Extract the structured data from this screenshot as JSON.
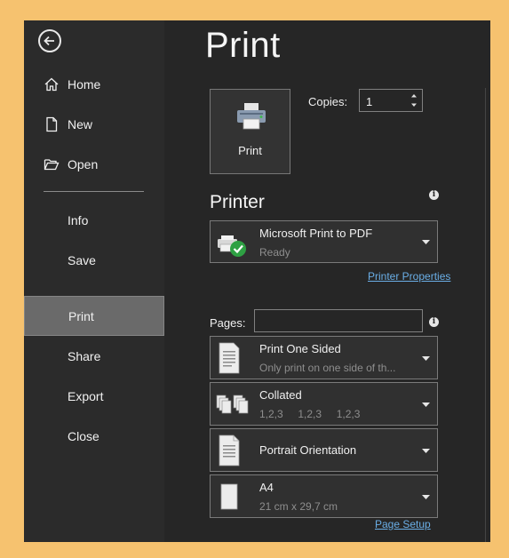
{
  "sidebar": {
    "items": [
      {
        "label": "Home",
        "icon": "home-icon"
      },
      {
        "label": "New",
        "icon": "new-document-icon"
      },
      {
        "label": "Open",
        "icon": "folder-open-icon"
      },
      {
        "label": "Info"
      },
      {
        "label": "Save"
      },
      {
        "label": "Print",
        "active": true
      },
      {
        "label": "Share"
      },
      {
        "label": "Export"
      },
      {
        "label": "Close"
      }
    ]
  },
  "main": {
    "title": "Print",
    "print_button_label": "Print",
    "copies_label": "Copies:",
    "copies_value": "1",
    "printer_section_title": "Printer",
    "printer": {
      "name": "Microsoft Print to PDF",
      "status": "Ready"
    },
    "printer_properties_link": "Printer Properties",
    "pages_label": "Pages:",
    "pages_value": "",
    "sides": {
      "title": "Print One Sided",
      "subtitle": "Only print on one side of th..."
    },
    "collation": {
      "title": "Collated",
      "sequence": [
        "1,2,3",
        "1,2,3",
        "1,2,3"
      ]
    },
    "orientation": {
      "title": "Portrait Orientation"
    },
    "paper": {
      "title": "A4",
      "subtitle": "21 cm x 29,7 cm"
    },
    "page_setup_link": "Page Setup"
  },
  "colors": {
    "background": "#262626",
    "sidebar": "#2b2b2b",
    "active_item": "#6a6a6a",
    "link": "#6aaee6",
    "ready_check": "#2ea043",
    "frame": "#f6c26f"
  }
}
